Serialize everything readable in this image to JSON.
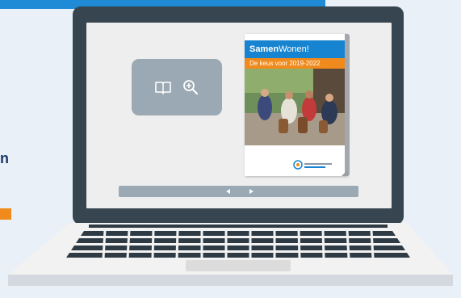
{
  "side_heading": "n",
  "brochure": {
    "brand_bold": "Samen",
    "brand_light": "Wonen!",
    "subtitle": "De keus voor 2019-2022"
  },
  "icons": {
    "read": "book-icon",
    "zoom": "zoom-in-icon",
    "prev": "chevron-left-icon",
    "next": "chevron-right-icon"
  },
  "colors": {
    "accent_blue": "#1684d0",
    "accent_orange": "#f08a1c",
    "laptop": "#36454f",
    "panel_grey": "#9aa9b3",
    "background": "#e9f0f8"
  }
}
